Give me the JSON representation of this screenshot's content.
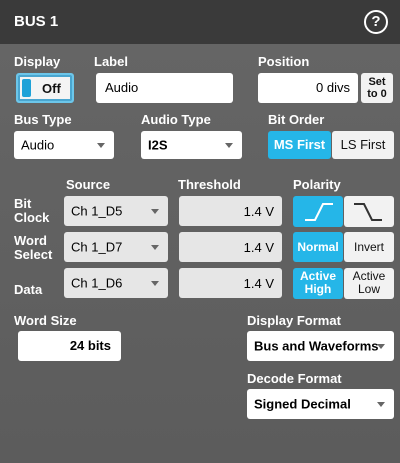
{
  "window": {
    "title": "BUS 1"
  },
  "labels": {
    "display": "Display",
    "label": "Label",
    "position": "Position",
    "bus_type": "Bus Type",
    "audio_type": "Audio Type",
    "bit_order": "Bit Order",
    "source": "Source",
    "threshold": "Threshold",
    "polarity": "Polarity",
    "bit_clock": "Bit\nClock",
    "word_select": "Word\nSelect",
    "data": "Data",
    "word_size": "Word Size",
    "display_format": "Display Format",
    "decode_format": "Decode Format"
  },
  "values": {
    "display_toggle": "Off",
    "label_text": "Audio",
    "position": "0 divs",
    "set_to_zero": "Set\nto 0",
    "bus_type": "Audio",
    "audio_type": "I2S",
    "bit_order": {
      "selected": "MS First",
      "other": "LS First"
    },
    "source": [
      "Ch 1_D5",
      "Ch 1_D7",
      "Ch 1_D6"
    ],
    "threshold": [
      "1.4 V",
      "1.4 V",
      "1.4 V"
    ],
    "polarity_clock": {
      "rising_selected": true
    },
    "polarity_ws": {
      "selected": "Normal",
      "other": "Invert"
    },
    "polarity_data": {
      "selected": "Active\nHigh",
      "other": "Active\nLow"
    },
    "word_size": "24 bits",
    "display_format": "Bus and Waveforms",
    "decode_format": "Signed Decimal"
  },
  "colors": {
    "accent": "#25b6e8",
    "titlebar": "#3a3a3a",
    "panel": "#5f5f5f"
  },
  "icons": {
    "help": "question-circle-icon",
    "rising_edge": "rising-edge-icon",
    "falling_edge": "falling-edge-icon"
  }
}
